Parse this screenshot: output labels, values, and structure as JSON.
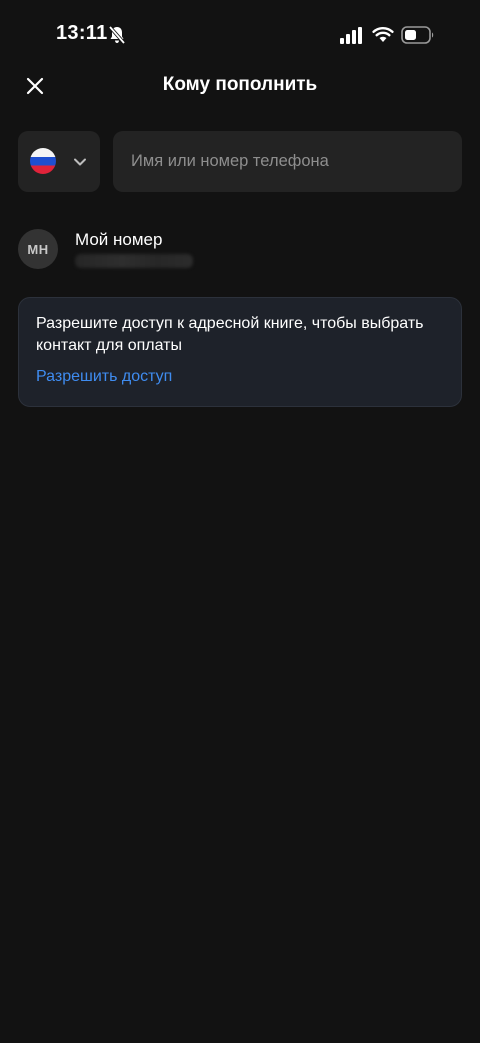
{
  "status_bar": {
    "time": "13:11"
  },
  "header": {
    "title": "Кому пополнить"
  },
  "country": {
    "flag": "ru-flag-icon"
  },
  "search": {
    "placeholder": "Имя или номер телефона",
    "value": ""
  },
  "my_number": {
    "avatar_initials": "МН",
    "name": "Мой номер"
  },
  "contacts_access": {
    "message": "Разрешите доступ к адресной книге, чтобы выбрать контакт для оплаты",
    "action_label": "Разрешить доступ"
  },
  "colors": {
    "background": "#121212",
    "surface": "#232323",
    "card": "#1e222a",
    "link": "#3f8cf0",
    "placeholder": "#8e8e8e"
  }
}
